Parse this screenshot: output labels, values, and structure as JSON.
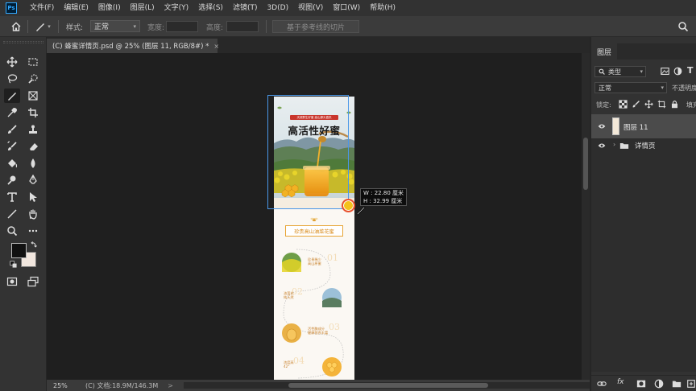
{
  "app": {
    "logo": "Ps",
    "menus": [
      "文件(F)",
      "编辑(E)",
      "图像(I)",
      "图层(L)",
      "文字(Y)",
      "选择(S)",
      "滤镜(T)",
      "3D(D)",
      "视图(V)",
      "窗口(W)",
      "帮助(H)"
    ]
  },
  "options": {
    "style_label": "样式:",
    "style_value": "正常",
    "width_label": "宽度:",
    "height_label": "高度:",
    "guides_button": "基于参考线的切片"
  },
  "document": {
    "tab_title": "(C) 蜂蜜详情页.psd @ 25% (图层 11, RGB/8#) *",
    "close_glyph": "×"
  },
  "artwork": {
    "hero_headline": "高活性好蜜",
    "hero_tagline": "天然野生好蜜 高山源头直供",
    "section_title": "珍贵高山油菜花蜜",
    "features": [
      {
        "text": "珍贵稀少\n高山原蜜",
        "num": "01"
      },
      {
        "text": "油菜花\n纯天然",
        "num": "02"
      },
      {
        "text": "活性酶成分\n健康营养丰富",
        "num": "03"
      },
      {
        "text": "浓度高\n42°",
        "num": "04"
      }
    ]
  },
  "tooltip": {
    "width": "W :  22.80 厘米",
    "height": "H :  32.99 厘米"
  },
  "status": {
    "zoom": "25%",
    "doc_info": "(C)  文档:18.9M/146.3M",
    "arrow": ">"
  },
  "panels": {
    "tab_layers": "图层",
    "filter_kind": "类型",
    "blend_mode": "正常",
    "opacity_label": "不透明度",
    "lock_label": "锁定:",
    "fill_label": "填充",
    "layers": [
      {
        "name": "图层 11",
        "selected": true
      },
      {
        "name": "详情页",
        "type": "group"
      }
    ]
  },
  "colors": {
    "accent": "#31a8ff",
    "selection": "#4a97e8",
    "honey": "#f0a01f",
    "foreground": "#111111",
    "background": "#f1e6de"
  }
}
